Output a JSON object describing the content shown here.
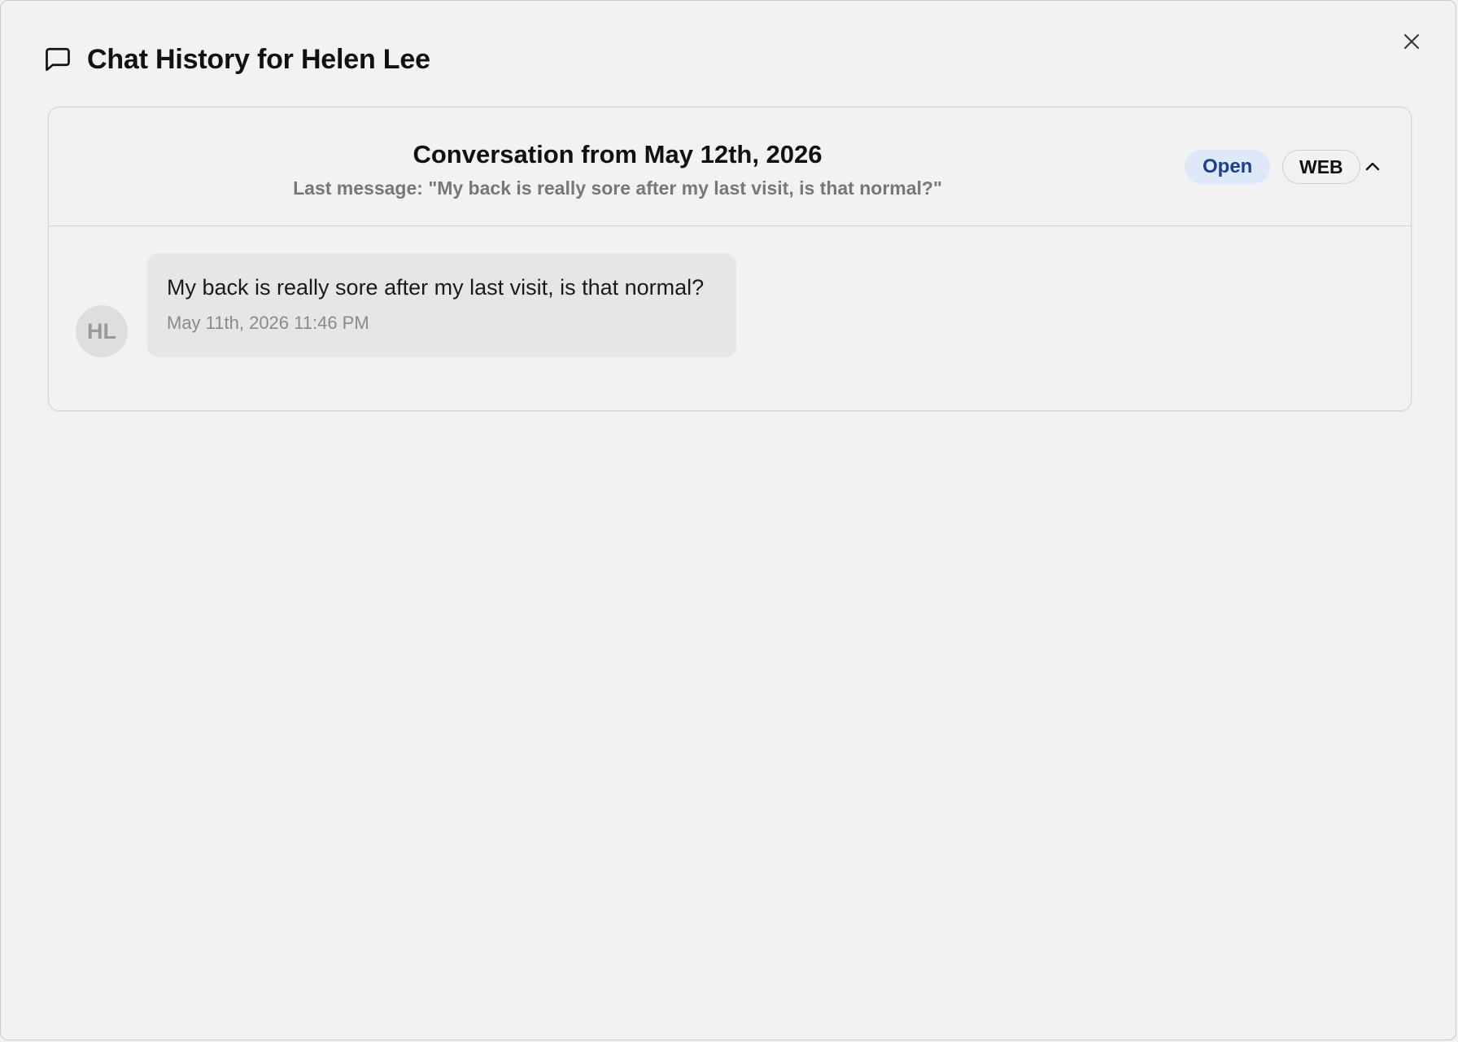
{
  "dialog": {
    "title": "Chat History for Helen Lee",
    "icons": {
      "title": "chat-bubble-icon",
      "close": "close-icon"
    }
  },
  "conversation": {
    "title": "Conversation from May 12th, 2026",
    "last_message": "Last message: \"My back is really sore after my last visit, is that normal?\"",
    "status": "Open",
    "channel": "WEB",
    "toggle_icon": "chevron-up-icon",
    "messages": [
      {
        "avatar_initials": "HL",
        "text": "My back is really sore after my last visit, is that normal?",
        "timestamp": "May 11th, 2026 11:46 PM"
      }
    ]
  },
  "colors": {
    "background": "#f2f2f2",
    "status_open_bg": "#dde8f8",
    "status_open_text": "#1d3f8f",
    "bubble_bg": "#e6e6e6",
    "avatar_bg": "#dedede"
  }
}
